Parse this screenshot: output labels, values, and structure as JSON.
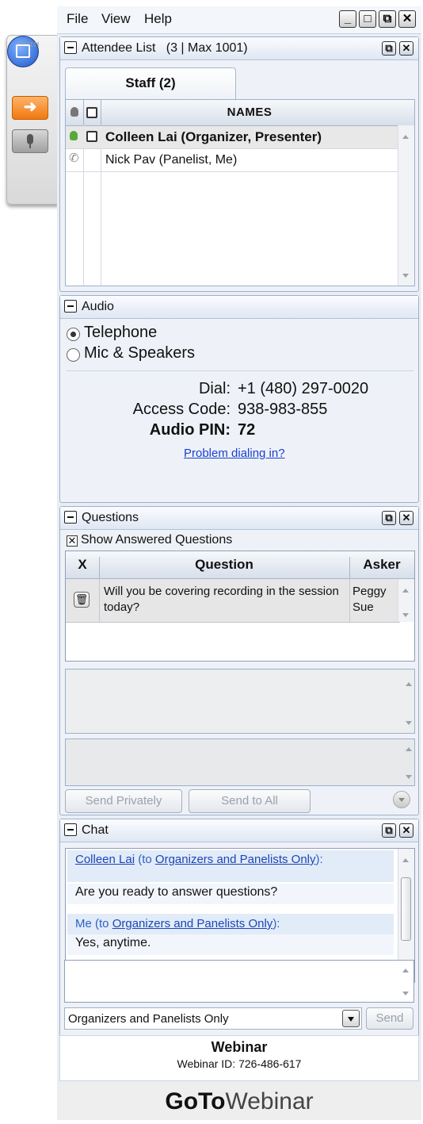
{
  "menu": {
    "file": "File",
    "view": "View",
    "help": "Help"
  },
  "window_controls": {
    "minimize": "_",
    "maximize": "□",
    "restore": "⧉",
    "close": "✕"
  },
  "attendee": {
    "title": "Attendee List",
    "count": "(3 | Max 1001)",
    "tab": "Staff (2)",
    "column_names": "NAMES",
    "rows": [
      {
        "name": "Colleen Lai (Organizer, Presenter)"
      },
      {
        "name": "Nick Pav (Panelist, Me)"
      }
    ]
  },
  "audio": {
    "title": "Audio",
    "options": [
      "Telephone",
      "Mic & Speakers"
    ],
    "selected": "Telephone",
    "dial_label": "Dial:",
    "dial_value": "+1 (480) 297-0020",
    "access_label": "Access Code:",
    "access_value": "938-983-855",
    "pin_label": "Audio PIN:",
    "pin_value": "72",
    "problem_link": "Problem dialing in?"
  },
  "questions": {
    "title": "Questions",
    "show_answered": "Show Answered Questions",
    "col_x": "X",
    "col_question": "Question",
    "col_asker": "Asker",
    "rows": [
      {
        "question": "Will you be covering recording in the session today?",
        "asker": "Peggy Sue"
      }
    ],
    "send_privately": "Send Privately",
    "send_to_all": "Send to All"
  },
  "chat": {
    "title": "Chat",
    "messages": [
      {
        "sender": "Colleen Lai",
        "to_prefix": "(to ",
        "to": "Organizers and Panelists Only",
        "to_suffix": "):",
        "text": "Are you ready to answer questions?"
      },
      {
        "sender": "Me",
        "to_prefix": "(to ",
        "to": "Organizers and Panelists Only",
        "to_suffix": "):",
        "text": "Yes, anytime."
      }
    ],
    "recipient": "Organizers and Panelists Only",
    "send": "Send"
  },
  "footer": {
    "title": "Webinar",
    "webinar_id": "Webinar ID: 726-486-617",
    "brand_bold": "GoTo",
    "brand_light": "Webinar"
  },
  "colors": {
    "accent_orange": "#f0790f",
    "link_blue": "#1a3fd0",
    "presenter_green": "#59a83a"
  }
}
